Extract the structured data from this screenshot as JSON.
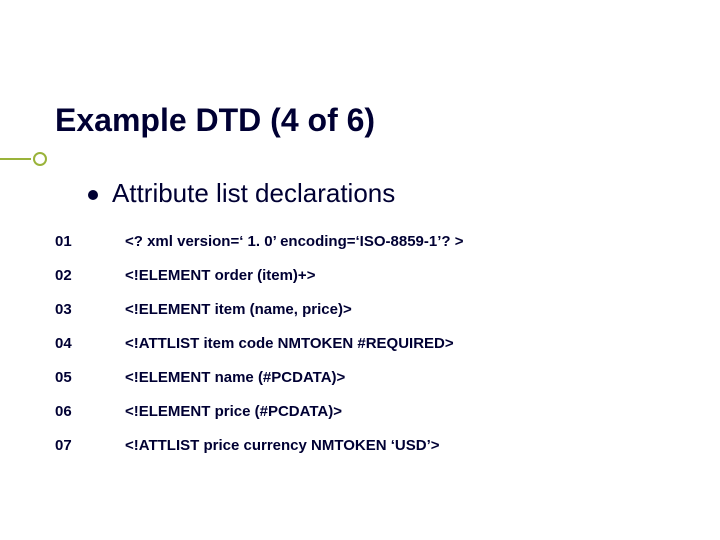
{
  "title": "Example DTD (4 of 6)",
  "subtitle": "Attribute list declarations",
  "lines": [
    {
      "num": "01",
      "content": "<? xml version=‘ 1. 0’ encoding=‘ISO-8859-1’? >"
    },
    {
      "num": "02",
      "content": "<!ELEMENT order (item)+>"
    },
    {
      "num": "03",
      "content": "<!ELEMENT item (name, price)>"
    },
    {
      "num": "04",
      "content": "<!ATTLIST item code NMTOKEN #REQUIRED>"
    },
    {
      "num": "05",
      "content": "<!ELEMENT name (#PCDATA)>"
    },
    {
      "num": "06",
      "content": "<!ELEMENT price (#PCDATA)>"
    },
    {
      "num": "07",
      "content": "<!ATTLIST price currency NMTOKEN ‘USD’>"
    }
  ],
  "accent_color": "#9ab33a"
}
